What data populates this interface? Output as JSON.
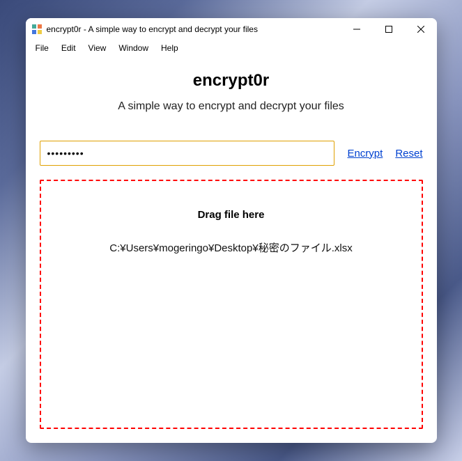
{
  "window": {
    "title": "encrypt0r - A simple way to encrypt and decrypt your files"
  },
  "menu": {
    "items": [
      "File",
      "Edit",
      "View",
      "Window",
      "Help"
    ]
  },
  "app": {
    "title": "encrypt0r",
    "subtitle": "A simple way to encrypt and decrypt your files"
  },
  "form": {
    "password_value": "•••••••••",
    "encrypt_label": "Encrypt",
    "reset_label": "Reset"
  },
  "dropzone": {
    "title": "Drag file here",
    "file_path": "C:¥Users¥mogeringo¥Desktop¥秘密のファイル.xlsx"
  }
}
